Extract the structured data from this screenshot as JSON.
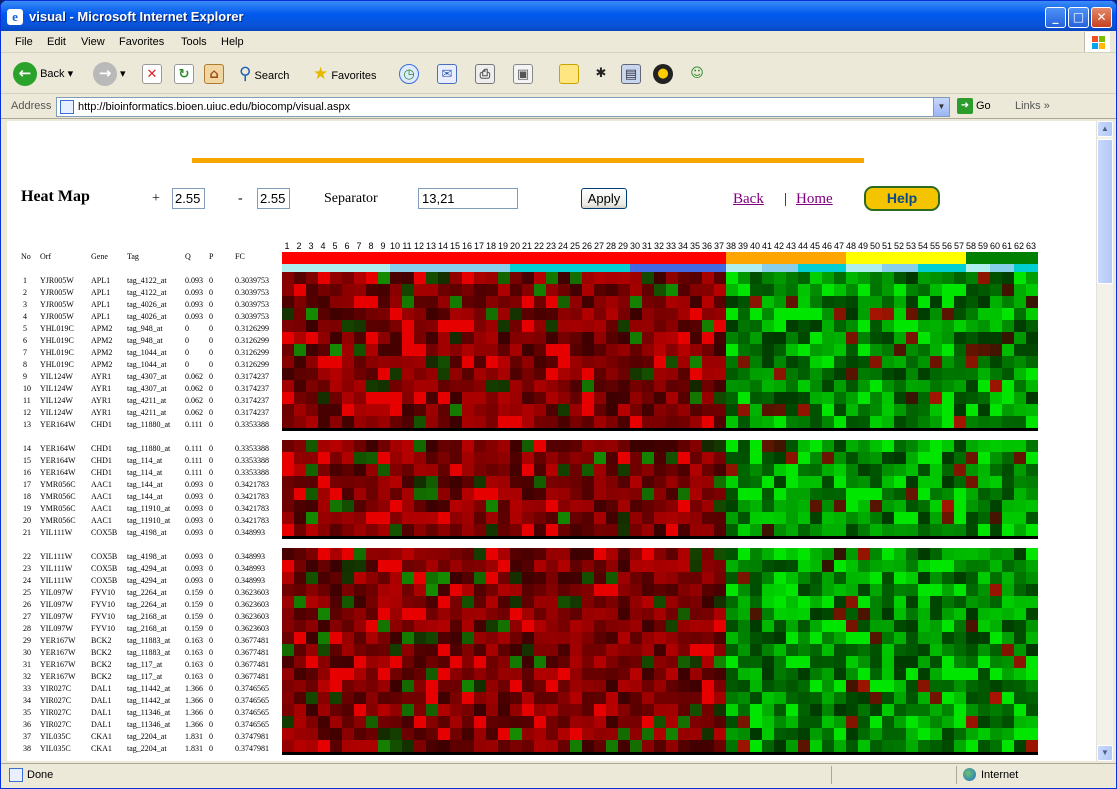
{
  "window": {
    "title": "visual - Microsoft Internet Explorer"
  },
  "menu": [
    "File",
    "Edit",
    "View",
    "Favorites",
    "Tools",
    "Help"
  ],
  "toolbar": {
    "back": "Back",
    "search": "Search",
    "favorites": "Favorites"
  },
  "address": {
    "label": "Address",
    "url": "http://bioinformatics.bioen.uiuc.edu/biocomp/visual.aspx",
    "go": "Go",
    "links": "Links"
  },
  "status": {
    "text": "Done",
    "zone": "Internet"
  },
  "controls": {
    "title": "Heat Map",
    "plus": "+",
    "plus_value": "2.55",
    "minus": "-",
    "minus_value": "2.55",
    "separator_label": "Separator",
    "separator_value": "13,21",
    "apply": "Apply",
    "back": "Back",
    "pipe": "|",
    "home": "Home",
    "help": "Help"
  },
  "table": {
    "headers": [
      "No",
      "Orf",
      "Gene",
      "Tag",
      "Q",
      "P",
      "FC"
    ],
    "column_numbers": [
      "1",
      "2",
      "3",
      "4",
      "5",
      "6",
      "7",
      "8",
      "9",
      "10",
      "11",
      "12",
      "13",
      "14",
      "15",
      "16",
      "17",
      "18",
      "19",
      "20",
      "21",
      "22",
      "23",
      "24",
      "25",
      "26",
      "27",
      "28",
      "29",
      "30",
      "31",
      "32",
      "33",
      "34",
      "35",
      "36",
      "37",
      "38",
      "39",
      "40",
      "41",
      "42",
      "43",
      "44",
      "45",
      "46",
      "47",
      "48",
      "49",
      "50",
      "51",
      "52",
      "53",
      "54",
      "55",
      "56",
      "57",
      "58",
      "59",
      "60",
      "61",
      "62",
      "63"
    ],
    "groups": [
      [
        [
          "1",
          "YJR005W",
          "APL1",
          "tag_4122_at",
          "0.093",
          "0",
          "0.3039753"
        ],
        [
          "2",
          "YJR005W",
          "APL1",
          "tag_4122_at",
          "0.093",
          "0",
          "0.3039753"
        ],
        [
          "3",
          "YJR005W",
          "APL1",
          "tag_4026_at",
          "0.093",
          "0",
          "0.3039753"
        ],
        [
          "4",
          "YJR005W",
          "APL1",
          "tag_4026_at",
          "0.093",
          "0",
          "0.3039753"
        ],
        [
          "5",
          "YHL019C",
          "APM2",
          "tag_948_at",
          "0",
          "0",
          "0.3126299"
        ],
        [
          "6",
          "YHL019C",
          "APM2",
          "tag_948_at",
          "0",
          "0",
          "0.3126299"
        ],
        [
          "7",
          "YHL019C",
          "APM2",
          "tag_1044_at",
          "0",
          "0",
          "0.3126299"
        ],
        [
          "8",
          "YHL019C",
          "APM2",
          "tag_1044_at",
          "0",
          "0",
          "0.3126299"
        ],
        [
          "9",
          "YIL124W",
          "AYR1",
          "tag_4307_at",
          "0.062",
          "0",
          "0.3174237"
        ],
        [
          "10",
          "YIL124W",
          "AYR1",
          "tag_4307_at",
          "0.062",
          "0",
          "0.3174237"
        ],
        [
          "11",
          "YIL124W",
          "AYR1",
          "tag_4211_at",
          "0.062",
          "0",
          "0.3174237"
        ],
        [
          "12",
          "YIL124W",
          "AYR1",
          "tag_4211_at",
          "0.062",
          "0",
          "0.3174237"
        ],
        [
          "13",
          "YER164W",
          "CHD1",
          "tag_11880_at",
          "0.111",
          "0",
          "0.3353388"
        ]
      ],
      [
        [
          "14",
          "YER164W",
          "CHD1",
          "tag_11880_at",
          "0.111",
          "0",
          "0.3353388"
        ],
        [
          "15",
          "YER164W",
          "CHD1",
          "tag_114_at",
          "0.111",
          "0",
          "0.3353388"
        ],
        [
          "16",
          "YER164W",
          "CHD1",
          "tag_114_at",
          "0.111",
          "0",
          "0.3353388"
        ],
        [
          "17",
          "YMR056C",
          "AAC1",
          "tag_144_at",
          "0.093",
          "0",
          "0.3421783"
        ],
        [
          "18",
          "YMR056C",
          "AAC1",
          "tag_144_at",
          "0.093",
          "0",
          "0.3421783"
        ],
        [
          "19",
          "YMR056C",
          "AAC1",
          "tag_11910_at",
          "0.093",
          "0",
          "0.3421783"
        ],
        [
          "20",
          "YMR056C",
          "AAC1",
          "tag_11910_at",
          "0.093",
          "0",
          "0.3421783"
        ],
        [
          "21",
          "YIL111W",
          "COX5B",
          "tag_4198_at",
          "0.093",
          "0",
          "0.348993"
        ]
      ],
      [
        [
          "22",
          "YIL111W",
          "COX5B",
          "tag_4198_at",
          "0.093",
          "0",
          "0.348993"
        ],
        [
          "23",
          "YIL111W",
          "COX5B",
          "tag_4294_at",
          "0.093",
          "0",
          "0.348993"
        ],
        [
          "24",
          "YIL111W",
          "COX5B",
          "tag_4294_at",
          "0.093",
          "0",
          "0.348993"
        ],
        [
          "25",
          "YIL097W",
          "FYV10",
          "tag_2264_at",
          "0.159",
          "0",
          "0.3623603"
        ],
        [
          "26",
          "YIL097W",
          "FYV10",
          "tag_2264_at",
          "0.159",
          "0",
          "0.3623603"
        ],
        [
          "27",
          "YIL097W",
          "FYV10",
          "tag_2168_at",
          "0.159",
          "0",
          "0.3623603"
        ],
        [
          "28",
          "YIL097W",
          "FYV10",
          "tag_2168_at",
          "0.159",
          "0",
          "0.3623603"
        ],
        [
          "29",
          "YER167W",
          "BCK2",
          "tag_11883_at",
          "0.163",
          "0",
          "0.3677481"
        ],
        [
          "30",
          "YER167W",
          "BCK2",
          "tag_11883_at",
          "0.163",
          "0",
          "0.3677481"
        ],
        [
          "31",
          "YER167W",
          "BCK2",
          "tag_117_at",
          "0.163",
          "0",
          "0.3677481"
        ],
        [
          "32",
          "YER167W",
          "BCK2",
          "tag_117_at",
          "0.163",
          "0",
          "0.3677481"
        ],
        [
          "33",
          "YIR027C",
          "DAL1",
          "tag_11442_at",
          "1.366",
          "0",
          "0.3746565"
        ],
        [
          "34",
          "YIR027C",
          "DAL1",
          "tag_11442_at",
          "1.366",
          "0",
          "0.3746565"
        ],
        [
          "35",
          "YIR027C",
          "DAL1",
          "tag_11346_at",
          "1.366",
          "0",
          "0.3746565"
        ],
        [
          "36",
          "YIR027C",
          "DAL1",
          "tag_11346_at",
          "1.366",
          "0",
          "0.3746565"
        ],
        [
          "37",
          "YIL035C",
          "CKA1",
          "tag_2204_at",
          "1.831",
          "0",
          "0.3747981"
        ],
        [
          "38",
          "YIL035C",
          "CKA1",
          "tag_2204_at",
          "1.831",
          "0",
          "0.3747981"
        ]
      ]
    ]
  },
  "bands": {
    "condition": [
      {
        "from": 1,
        "to": 37,
        "color": "#ff0000"
      },
      {
        "from": 38,
        "to": 47,
        "color": "#ffa500"
      },
      {
        "from": 48,
        "to": 57,
        "color": "#ffff00"
      },
      {
        "from": 58,
        "to": 63,
        "color": "#008000"
      }
    ],
    "timepoint": [
      {
        "from": 1,
        "to": 9,
        "color": "#afeeee"
      },
      {
        "from": 10,
        "to": 19,
        "color": "#87ceeb"
      },
      {
        "from": 20,
        "to": 29,
        "color": "#00ced1"
      },
      {
        "from": 30,
        "to": 37,
        "color": "#4169e1"
      },
      {
        "from": 38,
        "to": 40,
        "color": "#afeeee"
      },
      {
        "from": 41,
        "to": 43,
        "color": "#87ceeb"
      },
      {
        "from": 44,
        "to": 47,
        "color": "#00ced1"
      },
      {
        "from": 48,
        "to": 50,
        "color": "#afeeee"
      },
      {
        "from": 51,
        "to": 53,
        "color": "#87ceeb"
      },
      {
        "from": 54,
        "to": 57,
        "color": "#00ced1"
      },
      {
        "from": 58,
        "to": 59,
        "color": "#afeeee"
      },
      {
        "from": 60,
        "to": 61,
        "color": "#87ceeb"
      },
      {
        "from": 62,
        "to": 63,
        "color": "#00ced1"
      }
    ]
  },
  "heatmap": {
    "columns": 63,
    "split_column": 37,
    "colors": {
      "up": "#ff0000",
      "down": "#00ff00",
      "zero": "#000000"
    }
  }
}
